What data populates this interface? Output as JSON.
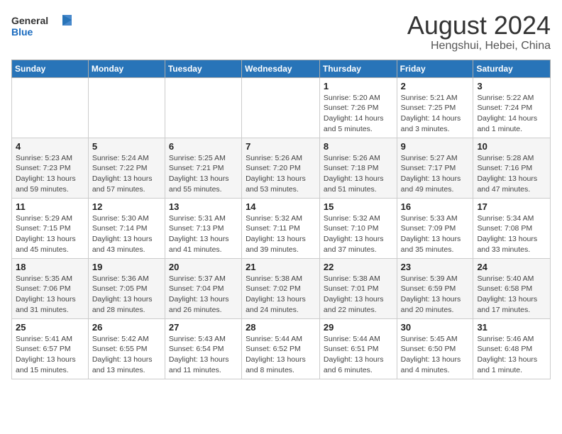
{
  "header": {
    "logo_general": "General",
    "logo_blue": "Blue",
    "main_title": "August 2024",
    "subtitle": "Hengshui, Hebei, China"
  },
  "weekdays": [
    "Sunday",
    "Monday",
    "Tuesday",
    "Wednesday",
    "Thursday",
    "Friday",
    "Saturday"
  ],
  "weeks": [
    [
      {
        "day": "",
        "info": ""
      },
      {
        "day": "",
        "info": ""
      },
      {
        "day": "",
        "info": ""
      },
      {
        "day": "",
        "info": ""
      },
      {
        "day": "1",
        "info": "Sunrise: 5:20 AM\nSunset: 7:26 PM\nDaylight: 14 hours\nand 5 minutes."
      },
      {
        "day": "2",
        "info": "Sunrise: 5:21 AM\nSunset: 7:25 PM\nDaylight: 14 hours\nand 3 minutes."
      },
      {
        "day": "3",
        "info": "Sunrise: 5:22 AM\nSunset: 7:24 PM\nDaylight: 14 hours\nand 1 minute."
      }
    ],
    [
      {
        "day": "4",
        "info": "Sunrise: 5:23 AM\nSunset: 7:23 PM\nDaylight: 13 hours\nand 59 minutes."
      },
      {
        "day": "5",
        "info": "Sunrise: 5:24 AM\nSunset: 7:22 PM\nDaylight: 13 hours\nand 57 minutes."
      },
      {
        "day": "6",
        "info": "Sunrise: 5:25 AM\nSunset: 7:21 PM\nDaylight: 13 hours\nand 55 minutes."
      },
      {
        "day": "7",
        "info": "Sunrise: 5:26 AM\nSunset: 7:20 PM\nDaylight: 13 hours\nand 53 minutes."
      },
      {
        "day": "8",
        "info": "Sunrise: 5:26 AM\nSunset: 7:18 PM\nDaylight: 13 hours\nand 51 minutes."
      },
      {
        "day": "9",
        "info": "Sunrise: 5:27 AM\nSunset: 7:17 PM\nDaylight: 13 hours\nand 49 minutes."
      },
      {
        "day": "10",
        "info": "Sunrise: 5:28 AM\nSunset: 7:16 PM\nDaylight: 13 hours\nand 47 minutes."
      }
    ],
    [
      {
        "day": "11",
        "info": "Sunrise: 5:29 AM\nSunset: 7:15 PM\nDaylight: 13 hours\nand 45 minutes."
      },
      {
        "day": "12",
        "info": "Sunrise: 5:30 AM\nSunset: 7:14 PM\nDaylight: 13 hours\nand 43 minutes."
      },
      {
        "day": "13",
        "info": "Sunrise: 5:31 AM\nSunset: 7:13 PM\nDaylight: 13 hours\nand 41 minutes."
      },
      {
        "day": "14",
        "info": "Sunrise: 5:32 AM\nSunset: 7:11 PM\nDaylight: 13 hours\nand 39 minutes."
      },
      {
        "day": "15",
        "info": "Sunrise: 5:32 AM\nSunset: 7:10 PM\nDaylight: 13 hours\nand 37 minutes."
      },
      {
        "day": "16",
        "info": "Sunrise: 5:33 AM\nSunset: 7:09 PM\nDaylight: 13 hours\nand 35 minutes."
      },
      {
        "day": "17",
        "info": "Sunrise: 5:34 AM\nSunset: 7:08 PM\nDaylight: 13 hours\nand 33 minutes."
      }
    ],
    [
      {
        "day": "18",
        "info": "Sunrise: 5:35 AM\nSunset: 7:06 PM\nDaylight: 13 hours\nand 31 minutes."
      },
      {
        "day": "19",
        "info": "Sunrise: 5:36 AM\nSunset: 7:05 PM\nDaylight: 13 hours\nand 28 minutes."
      },
      {
        "day": "20",
        "info": "Sunrise: 5:37 AM\nSunset: 7:04 PM\nDaylight: 13 hours\nand 26 minutes."
      },
      {
        "day": "21",
        "info": "Sunrise: 5:38 AM\nSunset: 7:02 PM\nDaylight: 13 hours\nand 24 minutes."
      },
      {
        "day": "22",
        "info": "Sunrise: 5:38 AM\nSunset: 7:01 PM\nDaylight: 13 hours\nand 22 minutes."
      },
      {
        "day": "23",
        "info": "Sunrise: 5:39 AM\nSunset: 6:59 PM\nDaylight: 13 hours\nand 20 minutes."
      },
      {
        "day": "24",
        "info": "Sunrise: 5:40 AM\nSunset: 6:58 PM\nDaylight: 13 hours\nand 17 minutes."
      }
    ],
    [
      {
        "day": "25",
        "info": "Sunrise: 5:41 AM\nSunset: 6:57 PM\nDaylight: 13 hours\nand 15 minutes."
      },
      {
        "day": "26",
        "info": "Sunrise: 5:42 AM\nSunset: 6:55 PM\nDaylight: 13 hours\nand 13 minutes."
      },
      {
        "day": "27",
        "info": "Sunrise: 5:43 AM\nSunset: 6:54 PM\nDaylight: 13 hours\nand 11 minutes."
      },
      {
        "day": "28",
        "info": "Sunrise: 5:44 AM\nSunset: 6:52 PM\nDaylight: 13 hours\nand 8 minutes."
      },
      {
        "day": "29",
        "info": "Sunrise: 5:44 AM\nSunset: 6:51 PM\nDaylight: 13 hours\nand 6 minutes."
      },
      {
        "day": "30",
        "info": "Sunrise: 5:45 AM\nSunset: 6:50 PM\nDaylight: 13 hours\nand 4 minutes."
      },
      {
        "day": "31",
        "info": "Sunrise: 5:46 AM\nSunset: 6:48 PM\nDaylight: 13 hours\nand 1 minute."
      }
    ]
  ]
}
